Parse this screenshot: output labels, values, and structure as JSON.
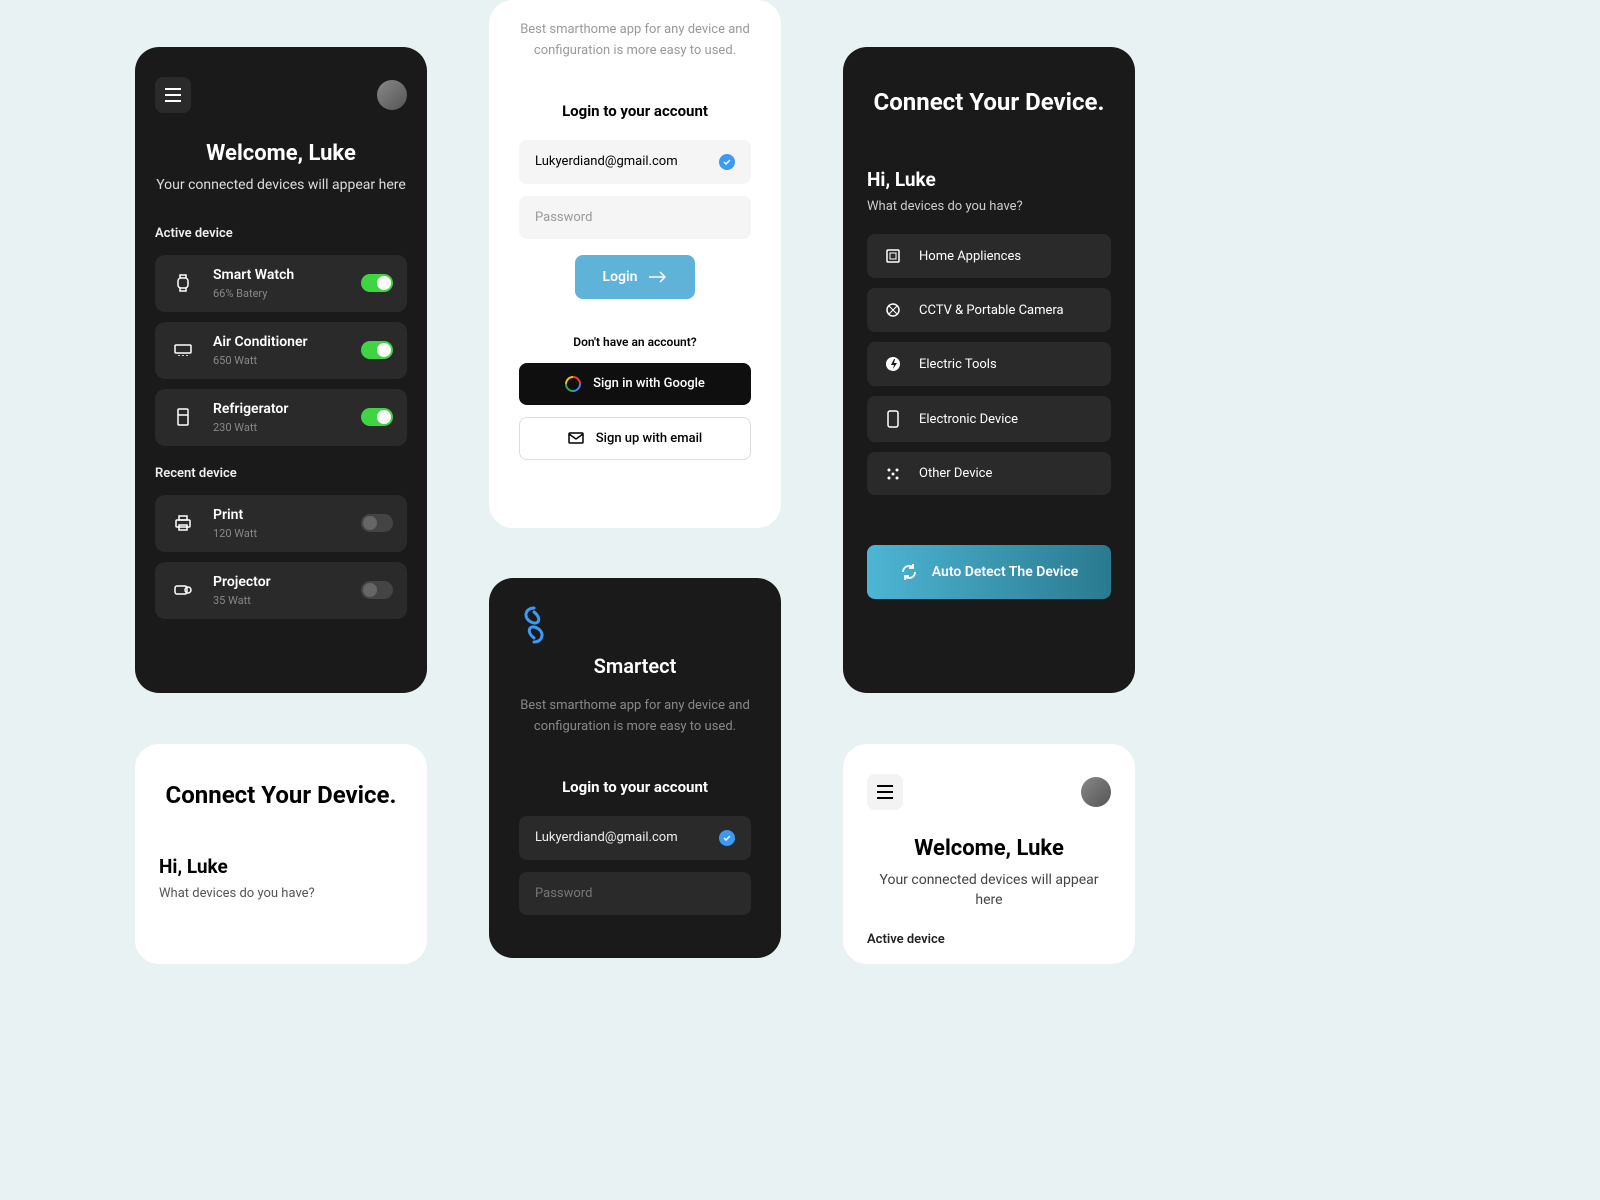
{
  "welcome": {
    "title": "Welcome, Luke",
    "subtitle": "Your connected devices will appear here",
    "active_label": "Active device",
    "recent_label": "Recent device",
    "devices": {
      "active": [
        {
          "name": "Smart Watch",
          "meta": "66% Batery",
          "on": true
        },
        {
          "name": "Air Conditioner",
          "meta": "650 Watt",
          "on": true
        },
        {
          "name": "Refrigerator",
          "meta": "230 Watt",
          "on": true
        }
      ],
      "recent": [
        {
          "name": "Print",
          "meta": "120 Watt",
          "on": false
        },
        {
          "name": "Projector",
          "meta": "35 Watt",
          "on": false
        }
      ]
    }
  },
  "login": {
    "tagline": "Best smarthome app for any device and configuration is more easy to used.",
    "title": "Login to your account",
    "email": "Lukyerdiand@gmail.com",
    "password_placeholder": "Password",
    "login_btn": "Login",
    "no_account": "Don't have an account?",
    "google_btn": "Sign in with Google",
    "email_btn": "Sign up with email",
    "brand": "Smartect"
  },
  "connect": {
    "title": "Connect Your Device.",
    "greeting": "Hi, Luke",
    "question": "What devices do you have?",
    "categories": [
      "Home Appliences",
      "CCTV & Portable Camera",
      "Electric Tools",
      "Electronic Device",
      "Other Device"
    ],
    "detect_btn": "Auto Detect The Device"
  },
  "colors": {
    "accent": "#5fb3d9",
    "toggle_on": "#3fd442"
  }
}
